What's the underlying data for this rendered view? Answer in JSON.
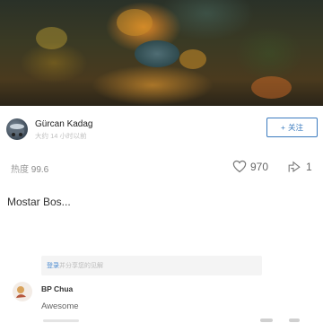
{
  "post": {
    "author_name": "Gürcan Kadag",
    "author_time": "大约 14 小时以前",
    "follow_label": "关注",
    "follow_icon": "+",
    "heat_label": "热度",
    "heat_value": "99.6",
    "likes": "970",
    "shares": "1",
    "title": "Mostar Bos..."
  },
  "comments": {
    "login_label": "登录",
    "input_placeholder": "并分享您的见解",
    "items": [
      {
        "name": "BP Chua",
        "text": "Awesome"
      }
    ]
  },
  "colors": {
    "accent": "#3b7bbf",
    "link": "#4a8ad0"
  }
}
